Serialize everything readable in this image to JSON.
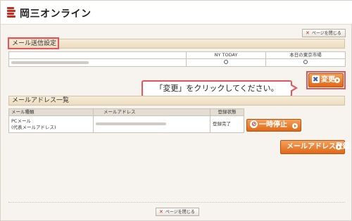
{
  "header": {
    "logo_text": "岡三オンライン"
  },
  "close_label": "ページを閉じる",
  "mail_settings": {
    "title": "メール送信設定",
    "columns": [
      "",
      "NY TODAY",
      "本日の東京市場"
    ],
    "change_button": "変更"
  },
  "tooltip": "「変更」をクリックしてください。",
  "address_list": {
    "title": "メールアドレス一覧",
    "columns": [
      "メール種類",
      "メールアドレス",
      "登録状態"
    ],
    "row": {
      "type_line1": "PCメール",
      "type_line2": "(代表メールアドレス)",
      "status": "登録完了",
      "stop_button": "一時停止"
    }
  },
  "register_button": "メールアドレス登録",
  "colors": {
    "accent": "#e06818",
    "highlight": "#e4555c",
    "logo": "#cc2a1a"
  }
}
